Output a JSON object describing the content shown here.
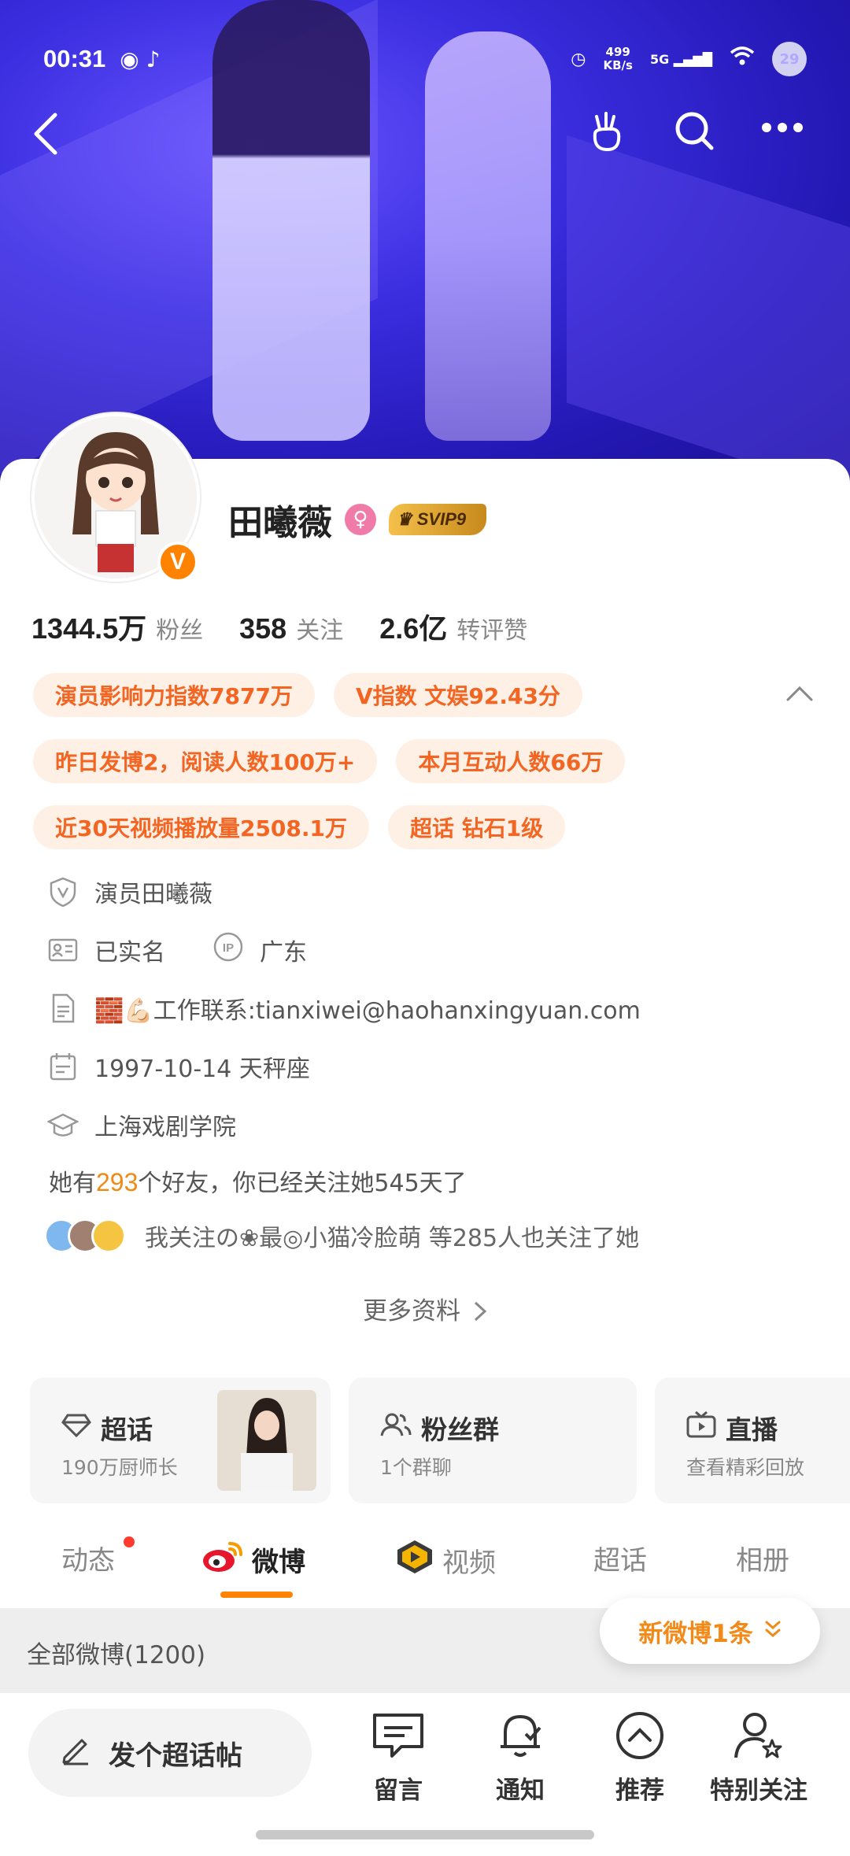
{
  "status": {
    "time": "00:31",
    "speed_top": "499",
    "speed_bottom": "KB/s",
    "network": "5G",
    "battery": "29"
  },
  "profile": {
    "name": "田曦薇",
    "svip": "SVIP9",
    "verified_badge": "V",
    "stats": [
      {
        "num": "1344.5万",
        "label": "粉丝"
      },
      {
        "num": "358",
        "label": "关注"
      },
      {
        "num": "2.6亿",
        "label": "转评赞"
      }
    ],
    "tags": [
      "演员影响力指数7877万",
      "V指数 文娱92.43分",
      "昨日发博2，阅读人数100万+",
      "本月互动人数66万",
      "近30天视频播放量2508.1万",
      "超话 钻石1级"
    ],
    "verification": "演员田曦薇",
    "real_name": "已实名",
    "ip_location": "广东",
    "bio_emoji": "🧱💪🏻",
    "bio": "工作联系:tianxiwei@haohanxingyuan.com",
    "birthday": "1997-10-14 天秤座",
    "school": "上海戏剧学院",
    "friends_pre": "她有",
    "friends_count": "293",
    "friends_post": "个好友，你已经关注她545天了",
    "mutual_text": "我关注の❀最◎小猫冷脸萌 等285人也关注了她",
    "more_label": "更多资料"
  },
  "features": [
    {
      "title": "超话",
      "sub": "190万厨师长"
    },
    {
      "title": "粉丝群",
      "sub": "1个群聊"
    },
    {
      "title": "直播",
      "sub": "查看精彩回放"
    }
  ],
  "tabs": [
    "动态",
    "微博",
    "视频",
    "超话",
    "相册"
  ],
  "filter": {
    "label": "全部微博(1200)",
    "new_pill": "新微博1条"
  },
  "bottom": {
    "post_label": "发个超话帖",
    "nav": [
      "留言",
      "通知",
      "推荐",
      "特别关注"
    ]
  },
  "colors": {
    "accent": "#ff8200",
    "tag_text": "#f26522",
    "tag_bg": "#fff0e6"
  }
}
